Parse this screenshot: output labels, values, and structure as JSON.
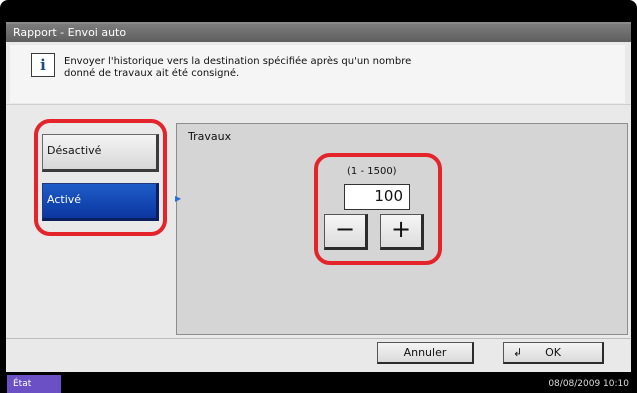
{
  "window": {
    "title": "Rapport - Envoi auto"
  },
  "info": {
    "icon": "info-icon",
    "line1": "Envoyer l'historique vers la destination spécifiée après qu'un nombre",
    "line2": "donné de travaux ait été consigné."
  },
  "options": [
    {
      "label": "Désactivé",
      "selected": false
    },
    {
      "label": "Activé",
      "selected": true
    }
  ],
  "travaux": {
    "label": "Travaux",
    "range": "(1 - 1500)",
    "value": "100",
    "minus": "−",
    "plus": "+"
  },
  "footer": {
    "cancel": "Annuler",
    "ok": "OK",
    "ok_icon": "return-arrow-icon"
  },
  "status": {
    "label": "État",
    "datetime": "08/08/2009   10:10"
  },
  "colors": {
    "accent_selected": "#0c36a0",
    "highlight_ring": "#e3242b",
    "status_label_bg": "#6a50c4"
  }
}
